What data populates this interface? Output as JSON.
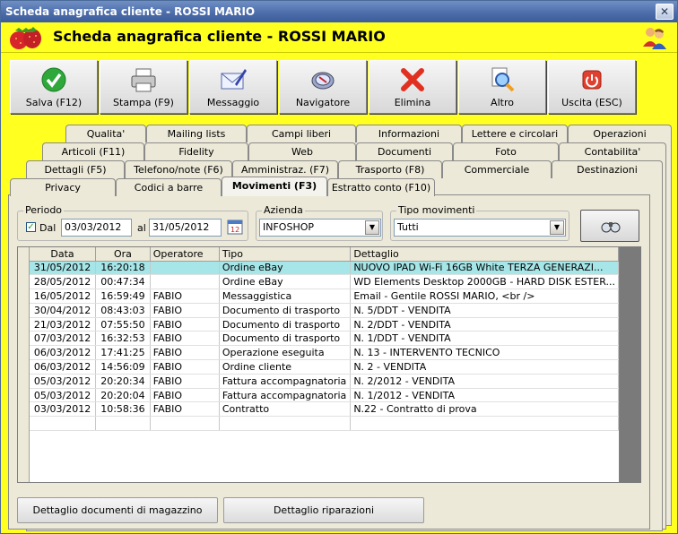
{
  "window": {
    "title": "Scheda anagrafica cliente - ROSSI MARIO",
    "close_glyph": "✕"
  },
  "header": {
    "title": "Scheda anagrafica cliente - ROSSI MARIO",
    "logo_icon": "strawberry-logo",
    "users_icon": "users-icon"
  },
  "toolbar": [
    {
      "label": "Salva (F12)",
      "icon": "check-icon"
    },
    {
      "label": "Stampa (F9)",
      "icon": "printer-icon"
    },
    {
      "label": "Messaggio",
      "icon": "envelope-icon"
    },
    {
      "label": "Navigatore",
      "icon": "compass-icon"
    },
    {
      "label": "Elimina",
      "icon": "delete-x-icon"
    },
    {
      "label": "Altro",
      "icon": "magnifier-icon"
    },
    {
      "label": "Uscita (ESC)",
      "icon": "power-icon"
    }
  ],
  "tabs": {
    "row1": [
      "Qualita'",
      "Mailing lists",
      "Campi liberi",
      "Informazioni",
      "Lettere e circolari",
      "Operazioni"
    ],
    "row2": [
      "Articoli (F11)",
      "Fidelity",
      "Web",
      "Documenti",
      "Foto",
      "Contabilita'"
    ],
    "row3": [
      "Dettagli (F5)",
      "Telefono/note (F6)",
      "Amministraz. (F7)",
      "Trasporto (F8)",
      "Commerciale",
      "Destinazioni"
    ],
    "row4": [
      "Privacy",
      "Codici a barre",
      "Movimenti (F3)",
      "Estratto conto (F10)"
    ],
    "active": "Movimenti (F3)"
  },
  "filters": {
    "periodo": {
      "title": "Periodo",
      "checkbox_label": "Dal",
      "checked": true,
      "from": "03/03/2012",
      "to_label": "al",
      "to": "31/05/2012"
    },
    "azienda": {
      "title": "Azienda",
      "value": "INFOSHOP"
    },
    "tipo": {
      "title": "Tipo movimenti",
      "value": "Tutti"
    }
  },
  "table": {
    "columns": [
      "Data",
      "Ora",
      "Operatore",
      "Tipo",
      "Dettaglio"
    ],
    "rows": [
      [
        "31/05/2012",
        "16:20:18",
        "",
        "Ordine eBay",
        "NUOVO IPAD Wi-Fi 16GB White TERZA  GENERAZI..."
      ],
      [
        "28/05/2012",
        "00:47:34",
        "",
        "Ordine eBay",
        "WD Elements Desktop 2000GB - HARD DISK ESTER..."
      ],
      [
        "16/05/2012",
        "16:59:49",
        "FABIO",
        "Messaggistica",
        "Email - Gentile ROSSI MARIO, <br />"
      ],
      [
        "30/04/2012",
        "08:43:03",
        "FABIO",
        "Documento di trasporto",
        "N. 5/DDT - VENDITA"
      ],
      [
        "21/03/2012",
        "07:55:50",
        "FABIO",
        "Documento di trasporto",
        "N. 2/DDT - VENDITA"
      ],
      [
        "07/03/2012",
        "16:32:53",
        "FABIO",
        "Documento di trasporto",
        "N. 1/DDT - VENDITA"
      ],
      [
        "06/03/2012",
        "17:41:25",
        "FABIO",
        "Operazione eseguita",
        "N. 13 - INTERVENTO TECNICO"
      ],
      [
        "06/03/2012",
        "14:56:09",
        "FABIO",
        "Ordine cliente",
        "N. 2 - VENDITA"
      ],
      [
        "05/03/2012",
        "20:20:34",
        "FABIO",
        "Fattura accompagnatoria",
        "N. 2/2012 - VENDITA"
      ],
      [
        "05/03/2012",
        "20:20:04",
        "FABIO",
        "Fattura accompagnatoria",
        "N. 1/2012 - VENDITA"
      ],
      [
        "03/03/2012",
        "10:58:36",
        "FABIO",
        "Contratto",
        "N.22 - Contratto di prova"
      ]
    ],
    "selected_row": 0
  },
  "buttons": {
    "magazzino": "Dettaglio documenti di magazzino",
    "riparazioni": "Dettaglio riparazioni"
  },
  "colors": {
    "header_yellow": "#ffff20",
    "titlebar": "#4a6ba8",
    "selected_row": "#a6e6e8"
  }
}
